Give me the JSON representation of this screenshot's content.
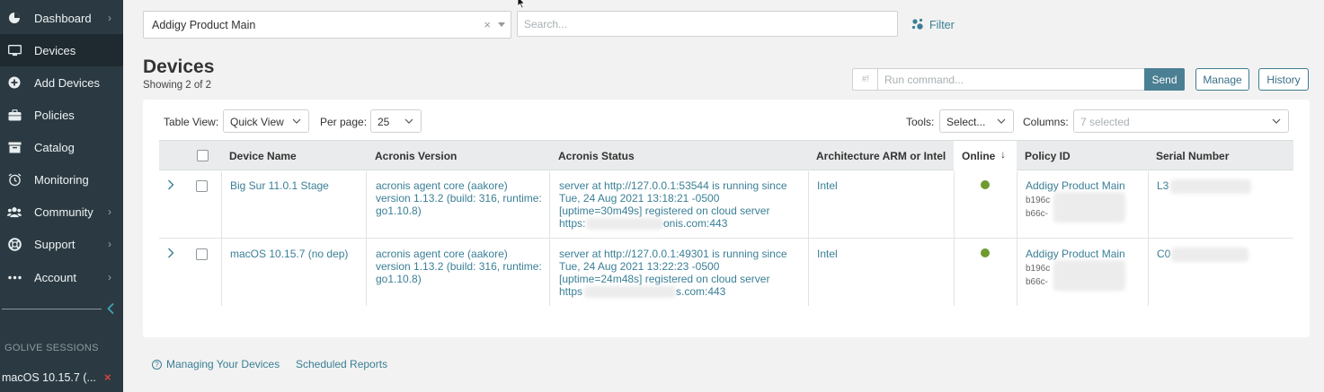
{
  "sidebar": {
    "items": [
      {
        "label": "Dashboard",
        "icon": "dashboard-icon",
        "chevron": true,
        "active": false
      },
      {
        "label": "Devices",
        "icon": "monitor-icon",
        "chevron": false,
        "active": true
      },
      {
        "label": "Add Devices",
        "icon": "plus-circle-icon",
        "chevron": false,
        "active": false
      },
      {
        "label": "Policies",
        "icon": "briefcase-icon",
        "chevron": false,
        "active": false
      },
      {
        "label": "Catalog",
        "icon": "catalog-icon",
        "chevron": false,
        "active": false
      },
      {
        "label": "Monitoring",
        "icon": "alarm-clock-icon",
        "chevron": false,
        "active": false
      },
      {
        "label": "Community",
        "icon": "users-icon",
        "chevron": true,
        "active": false
      },
      {
        "label": "Support",
        "icon": "lifebuoy-icon",
        "chevron": true,
        "active": false
      },
      {
        "label": "Account",
        "icon": "ellipsis-icon",
        "chevron": true,
        "active": false
      }
    ],
    "section_title": "GOLIVE SESSIONS",
    "session_label": "macOS 10.15.7 (...",
    "session_close": "×"
  },
  "topbar": {
    "policy_select_value": "Addigy Product Main",
    "clear_symbol": "×",
    "search_placeholder": "Search...",
    "filter_label": "Filter"
  },
  "header": {
    "title": "Devices",
    "subtitle": "Showing 2 of 2"
  },
  "command": {
    "prefix": "#!",
    "placeholder": "Run command...",
    "send_label": "Send",
    "manage_label": "Manage",
    "history_label": "History"
  },
  "table_controls": {
    "table_view_label": "Table View:",
    "table_view_value": "Quick View",
    "per_page_label": "Per page:",
    "per_page_value": "25",
    "tools_label": "Tools:",
    "tools_value": "Select...",
    "columns_label": "Columns:",
    "columns_value": "7 selected"
  },
  "table": {
    "headers": {
      "device_name": "Device Name",
      "acronis_version": "Acronis Version",
      "acronis_status": "Acronis Status",
      "architecture": "Architecture ARM or Intel",
      "online": "Online",
      "online_sort": "↓",
      "policy_id": "Policy ID",
      "serial_number": "Serial Number"
    },
    "rows": [
      {
        "device_name": "Big Sur 11.0.1 Stage",
        "version_lines": [
          "acronis agent core (aakore)",
          "version 1.13.2 (build: 316, runtime:",
          "go1.10.8)"
        ],
        "status_lines": [
          "server at http://127.0.0.1:53544 is running since",
          "Tue, 24 Aug 2021 13:18:21 -0500",
          "[uptime=30m49s] registered on cloud server"
        ],
        "status_url_start": "https:",
        "status_url_end": "onis.com:443",
        "architecture": "Intel",
        "policy_name": "Addigy Product Main",
        "policy_id_1": "b196c",
        "policy_id_2": "b66c-",
        "serial_prefix": "L3"
      },
      {
        "device_name": "macOS 10.15.7 (no dep)",
        "version_lines": [
          "acronis agent core (aakore)",
          "version 1.13.2 (build: 316, runtime:",
          "go1.10.8)"
        ],
        "status_lines": [
          "server at http://127.0.0.1:49301 is running since",
          "Tue, 24 Aug 2021 13:22:23 -0500",
          "[uptime=24m48s] registered on cloud server"
        ],
        "status_url_start": "https",
        "status_url_end": "s.com:443",
        "architecture": "Intel",
        "policy_name": "Addigy Product Main",
        "policy_id_1": "b196c",
        "policy_id_2": "b66c-",
        "serial_prefix": "C0"
      }
    ]
  },
  "footer": {
    "help_link": "Managing Your Devices",
    "reports_link": "Scheduled Reports"
  },
  "colors": {
    "sidebar_bg": "#2b3a42",
    "accent": "#3a7f96",
    "send_bg": "#4b7f93",
    "online": "#6f9a2f",
    "close": "#e0423a"
  }
}
